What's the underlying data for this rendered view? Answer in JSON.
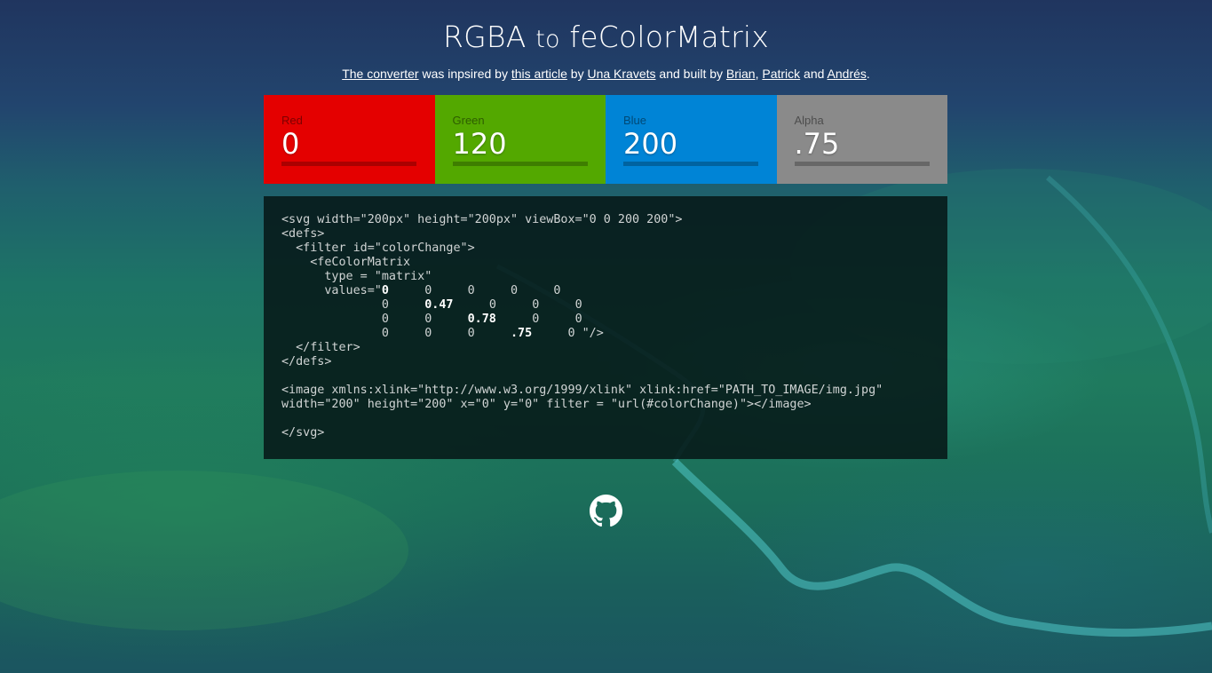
{
  "header": {
    "title_a": "RGBA",
    "title_to": "to",
    "title_b": "feColorMatrix"
  },
  "credits": {
    "link_converter": "The converter",
    "text_1": " was inpsired by ",
    "link_article": "this article",
    "text_2": " by ",
    "link_una": "Una Kravets",
    "text_3": " and built by ",
    "link_brian": "Brian",
    "text_4": ", ",
    "link_patrick": "Patrick",
    "text_5": " and ",
    "link_andres": "Andrés",
    "text_6": "."
  },
  "channels": [
    {
      "label": "Red",
      "value": "0",
      "color": "#e40000"
    },
    {
      "label": "Green",
      "value": "120",
      "color": "#53a800"
    },
    {
      "label": "Blue",
      "value": "200",
      "color": "#0084d6"
    },
    {
      "label": "Alpha",
      "value": ".75",
      "color": "#8a8a8a"
    }
  ],
  "code": {
    "line1": "<svg width=\"200px\" height=\"200px\" viewBox=\"0 0 200 200\">",
    "line2": "<defs>",
    "line3": "  <filter id=\"colorChange\">",
    "line4": "    <feColorMatrix",
    "line5": "      type = \"matrix\"",
    "line6_pre": "      values=\"",
    "line7_pre": "              ",
    "line8_pre": "              ",
    "line9_pre": "              ",
    "line10": "  </filter>",
    "line11": "</defs>",
    "line12": "<image xmlns:xlink=\"http://www.w3.org/1999/xlink\" xlink:href=\"PATH_TO_IMAGE/img.jpg\"",
    "line13": "width=\"200\" height=\"200\" x=\"0\" y=\"0\" filter = \"url(#colorChange)\"></image>",
    "line14": "</svg>",
    "matrix": {
      "r": "0",
      "g": "0.47",
      "b": "0.78",
      "a": ".75",
      "zero": "0",
      "end": " \"/>"
    }
  },
  "icons": {
    "github": "github-icon"
  }
}
